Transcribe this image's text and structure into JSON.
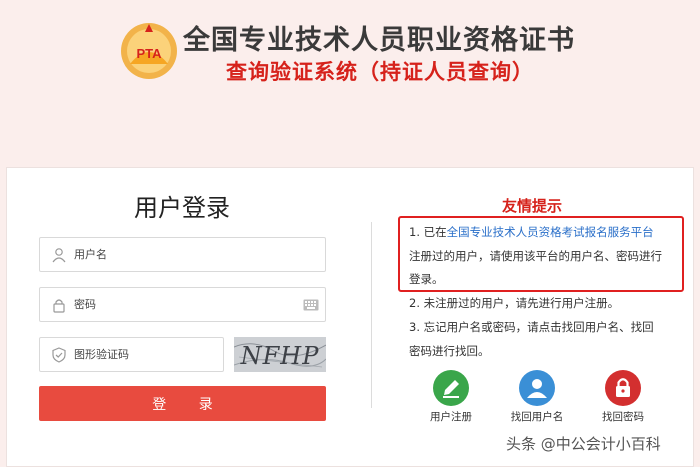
{
  "header": {
    "logo_text": "PTA",
    "title": "全国专业技术人员职业资格证书",
    "subtitle": "查询验证系统（持证人员查询）"
  },
  "login": {
    "title": "用户登录",
    "username_placeholder": "用户名",
    "password_placeholder": "密码",
    "captcha_placeholder": "图形验证码",
    "captcha_text": "NFHP",
    "submit_label": "登 录"
  },
  "tips": {
    "title": "友情提示",
    "tip1_prefix": "1. 已在",
    "tip1_link": "全国专业技术人员资格考试报名服务平台",
    "tip1_line2": "注册过的用户，请使用该平台的用户名、密码进行",
    "tip1_line3": "登录。",
    "tip2": "2. 未注册过的用户，请先进行用户注册。",
    "tip3_line1": "3. 忘记用户名或密码，请点击找回用户名、找回",
    "tip3_line2": "密码进行找回。"
  },
  "actions": {
    "register": "用户注册",
    "find_username": "找回用户名",
    "find_password": "找回密码"
  },
  "colors": {
    "brand_red": "#d6221b",
    "button_red": "#e84b3f",
    "register_green": "#3aa64a",
    "find_user_blue": "#3a8fd6",
    "find_pwd_red": "#d32f2f"
  },
  "watermark": "头条 @中公会计小百科"
}
